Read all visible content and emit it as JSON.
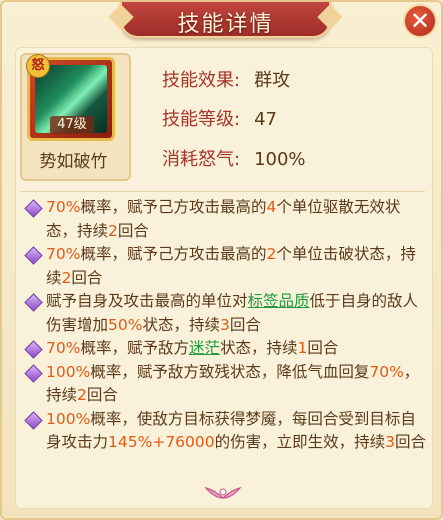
{
  "title": "技能详情",
  "close_symbol": "✕",
  "skill": {
    "badge": "怒",
    "level_tag": "47级",
    "name": "势如破竹",
    "attributes": [
      {
        "label": "技能效果:",
        "value": "群攻"
      },
      {
        "label": "技能等级:",
        "value": "47"
      },
      {
        "label": "消耗怒气:",
        "value": "100%"
      }
    ]
  },
  "colors": {
    "highlight": "#e45a13",
    "link": "#1f9a3e",
    "label": "#a6352a",
    "text": "#5b3a1c"
  },
  "effects": [
    [
      {
        "t": "70%",
        "c": "hl"
      },
      {
        "t": "概率，赋予己方攻击最高的"
      },
      {
        "t": "4",
        "c": "hl"
      },
      {
        "t": "个单位驱散无效状态，持续"
      },
      {
        "t": "2",
        "c": "hl"
      },
      {
        "t": "回合"
      }
    ],
    [
      {
        "t": "70%",
        "c": "hl"
      },
      {
        "t": "概率，赋予己方攻击最高的"
      },
      {
        "t": "2",
        "c": "hl"
      },
      {
        "t": "个单位击破状态，持续"
      },
      {
        "t": "2",
        "c": "hl"
      },
      {
        "t": "回合"
      }
    ],
    [
      {
        "t": "赋予自身及攻击最高的单位对"
      },
      {
        "t": "标签品质",
        "c": "lk"
      },
      {
        "t": "低于自身的敌人伤害增加"
      },
      {
        "t": "50%",
        "c": "hl"
      },
      {
        "t": "状态，持续"
      },
      {
        "t": "3",
        "c": "hl"
      },
      {
        "t": "回合"
      }
    ],
    [
      {
        "t": "70%",
        "c": "hl"
      },
      {
        "t": "概率，赋予敌方"
      },
      {
        "t": "迷茫",
        "c": "lk"
      },
      {
        "t": "状态，持续"
      },
      {
        "t": "1",
        "c": "hl"
      },
      {
        "t": "回合"
      }
    ],
    [
      {
        "t": "100%",
        "c": "hl"
      },
      {
        "t": "概率，赋予敌方致残状态，降低气血回复"
      },
      {
        "t": "70%",
        "c": "hl"
      },
      {
        "t": "，持续"
      },
      {
        "t": "2",
        "c": "hl"
      },
      {
        "t": "回合"
      }
    ],
    [
      {
        "t": "100%",
        "c": "hl"
      },
      {
        "t": "概率，使敌方目标获得梦魇，每回合受到目标自身攻击力"
      },
      {
        "t": "145%+76000",
        "c": "hl"
      },
      {
        "t": "的伤害，立即生效，持续"
      },
      {
        "t": "3",
        "c": "hl"
      },
      {
        "t": "回合"
      }
    ]
  ]
}
